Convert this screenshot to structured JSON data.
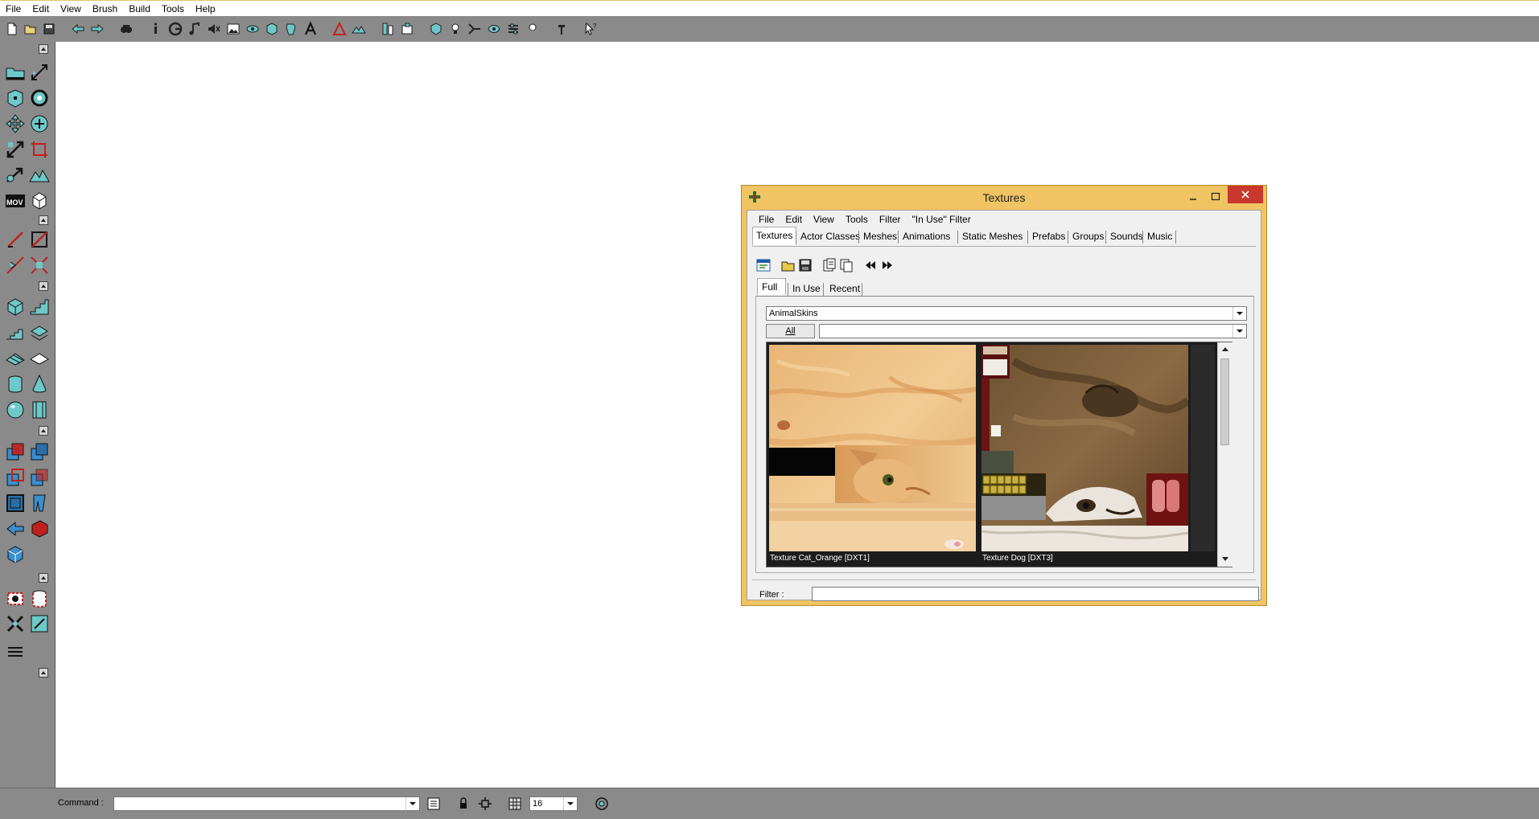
{
  "main_menu": [
    "File",
    "Edit",
    "View",
    "Brush",
    "Build",
    "Tools",
    "Help"
  ],
  "toolbox_icons": {
    "mov_label": "MOV"
  },
  "bottom_bar": {
    "command_label": "Command :",
    "command_value": "",
    "grid_value": "16"
  },
  "textures_window": {
    "title": "Textures",
    "menu": [
      "File",
      "Edit",
      "View",
      "Tools",
      "Filter",
      "\"In Use\" Filter"
    ],
    "tabs": [
      "Textures",
      "Actor Classes",
      "Meshes",
      "Animations",
      "Static Meshes",
      "Prefabs",
      "Groups",
      "Sounds",
      "Music"
    ],
    "subtabs": [
      "Full",
      "In Use",
      "Recent"
    ],
    "package_value": "AnimalSkins",
    "all_button": "All",
    "group_value": "",
    "textures": [
      {
        "caption": "Texture Cat_Orange [DXT1]"
      },
      {
        "caption": "Texture Dog [DXT3]"
      }
    ],
    "filter_label": "Filter :",
    "filter_value": ""
  },
  "colors": {
    "toolbar_gray": "#8a8a8a",
    "window_frame": "#f0c462",
    "close_red": "#c8382d"
  }
}
